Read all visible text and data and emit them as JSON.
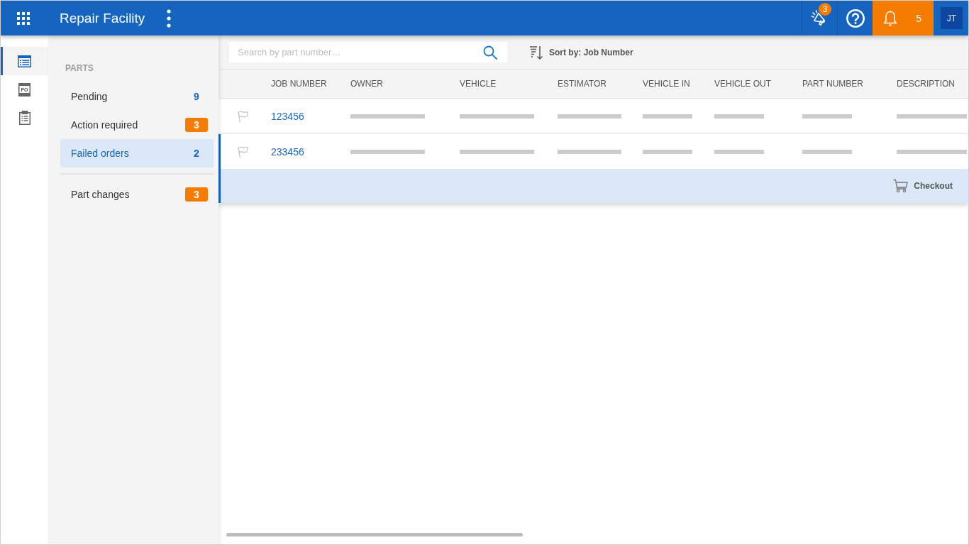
{
  "app_bar": {
    "title": "Repair Facility",
    "announcements_badge": "3",
    "notifications_count": "5",
    "user_initials": "JT"
  },
  "nav_rail": [
    {
      "kind": "list",
      "selected": true
    },
    {
      "kind": "purchase_order",
      "label": "PO",
      "selected": false
    },
    {
      "kind": "clipboard",
      "selected": false
    }
  ],
  "parts_panel": {
    "title": "PARTS",
    "groups": [
      {
        "items": [
          {
            "label": "Pending",
            "count": "9",
            "alert": false,
            "selected": false
          },
          {
            "label": "Action required",
            "count": "3",
            "alert": true,
            "selected": false
          },
          {
            "label": "Failed orders",
            "count": "2",
            "alert": false,
            "selected": true
          }
        ]
      },
      {
        "items": [
          {
            "label": "Part changes",
            "count": "3",
            "alert": true,
            "selected": false
          }
        ]
      }
    ]
  },
  "toolbar": {
    "search": {
      "placeholder": "Search by part number…"
    },
    "sort": {
      "label": "Sort by: Job Number"
    }
  },
  "table": {
    "columns": [
      "JOB NUMBER",
      "OWNER",
      "VEHICLE",
      "ESTIMATOR",
      "VEHICLE IN",
      "VEHICLE OUT",
      "PART NUMBER",
      "DESCRIPTION"
    ],
    "rows": [
      {
        "job_number": "123456",
        "flagged": false,
        "loading": true,
        "expanded": false
      },
      {
        "job_number": "233456",
        "flagged": false,
        "loading": true,
        "expanded": true,
        "action": {
          "label": "Checkout"
        }
      }
    ]
  }
}
